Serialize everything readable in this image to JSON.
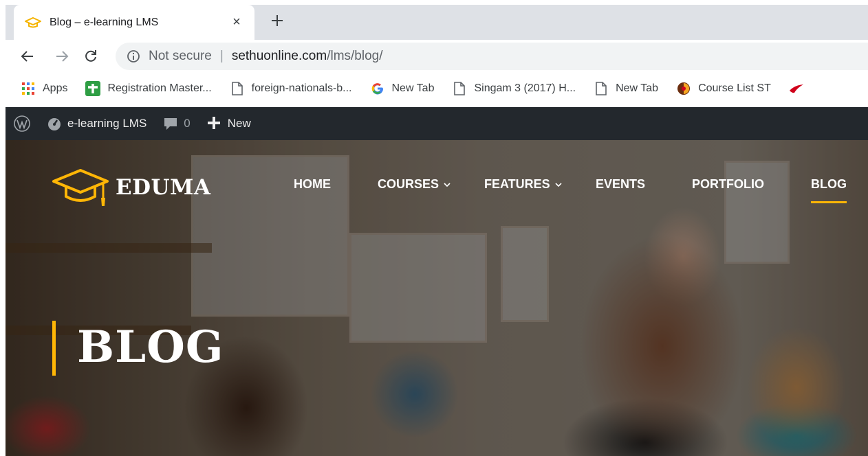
{
  "browser": {
    "tab": {
      "title": "Blog – e-learning LMS",
      "close_symbol": "×",
      "favicon": "graduation-cap-icon"
    },
    "new_tab_symbol": "+",
    "omnibox": {
      "security_label": "Not secure",
      "separator": "|",
      "url_host": "sethuonline.com",
      "url_path": "/lms/blog/"
    },
    "bookmarks": [
      {
        "label": "Apps",
        "icon": "apps-grid-icon"
      },
      {
        "label": "Registration Master...",
        "icon": "plus-cross-icon"
      },
      {
        "label": "foreign-nationals-b...",
        "icon": "page-icon"
      },
      {
        "label": "New Tab",
        "icon": "google-icon"
      },
      {
        "label": "Singam 3 (2017) H...",
        "icon": "page-icon"
      },
      {
        "label": "New Tab",
        "icon": "page-icon"
      },
      {
        "label": "Course List ST",
        "icon": "course-icon"
      }
    ]
  },
  "wp_admin_bar": {
    "site_name": "e-learning LMS",
    "comments_count": "0",
    "new_label": "New"
  },
  "site": {
    "brand": "EDUMA",
    "nav": [
      {
        "label": "HOME",
        "has_dropdown": false,
        "active": false
      },
      {
        "label": "COURSES",
        "has_dropdown": true,
        "active": false
      },
      {
        "label": "FEATURES",
        "has_dropdown": true,
        "active": false
      },
      {
        "label": "EVENTS",
        "has_dropdown": false,
        "active": false
      },
      {
        "label": "PORTFOLIO",
        "has_dropdown": false,
        "active": false
      },
      {
        "label": "BLOG",
        "has_dropdown": false,
        "active": true
      }
    ],
    "page_title": "BLOG"
  },
  "colors": {
    "accent": "#ffb606",
    "wp_bar": "#23282d",
    "tabstrip": "#dee1e6",
    "omnibox": "#f1f3f4"
  }
}
